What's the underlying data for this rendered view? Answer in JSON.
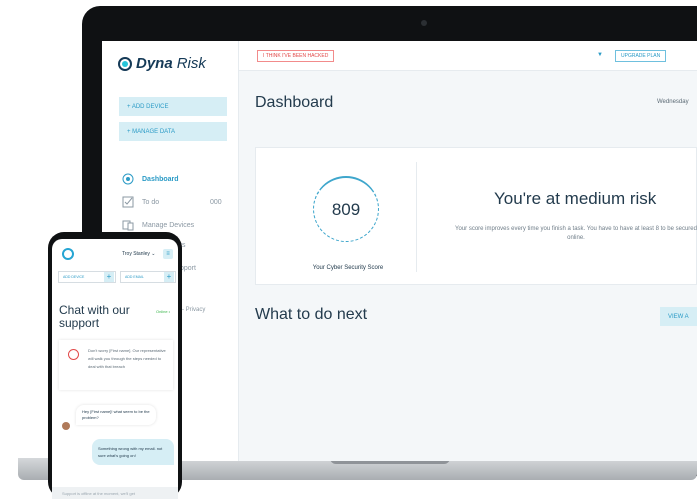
{
  "app": {
    "brand_bold": "Dyna",
    "brand_light": "Risk"
  },
  "sidebar": {
    "add_device": "+ ADD DEVICE",
    "manage_data": "+ MANAGE DATA",
    "items": [
      {
        "label": "Dashboard",
        "icon": "dashboard-icon"
      },
      {
        "label": "To do",
        "count": "000",
        "icon": "checkbox-icon"
      },
      {
        "label": "Manage Devices",
        "icon": "devices-icon"
      }
    ],
    "partial_link_1": "ts",
    "partial_link_2": "pport",
    "partial_footer": "s – Privacy"
  },
  "topbar": {
    "hacked_label": "I THINK I'VE BEEN HACKED",
    "dropdown_glyph": "▼",
    "upgrade_label": "UPGRADE PLAN"
  },
  "dashboard": {
    "title": "Dashboard",
    "date": "Wednesday",
    "score": "809",
    "score_label": "Your Cyber Security Score",
    "risk_title": "You're at medium risk",
    "risk_desc": "Your score improves every time you finish a task. You have to have at least 8 to be secured online.",
    "next_title": "What to do next",
    "view_all": "VIEW A"
  },
  "phone": {
    "user": "Troy Stanley ⌄",
    "menu_glyph": "≡",
    "add_device": "ADD DEVICE",
    "add_email": "ADD EMAIL",
    "chat_title": "Chat with our support",
    "status": "Online •",
    "bot_message": "Don't worry [First name]. Our representative will walk you through the steps needed to deal with that breach",
    "agent_message": "Hey [First name]! what seem to be the problem?",
    "user_reply": "Something wrong with my email. not sure what's going on!",
    "footer": "Support is offline at the moment, we'll get"
  },
  "colors": {
    "accent": "#2b9bc6",
    "danger": "#e24a4a",
    "text_dark": "#233b4d",
    "online": "#39b54a"
  }
}
